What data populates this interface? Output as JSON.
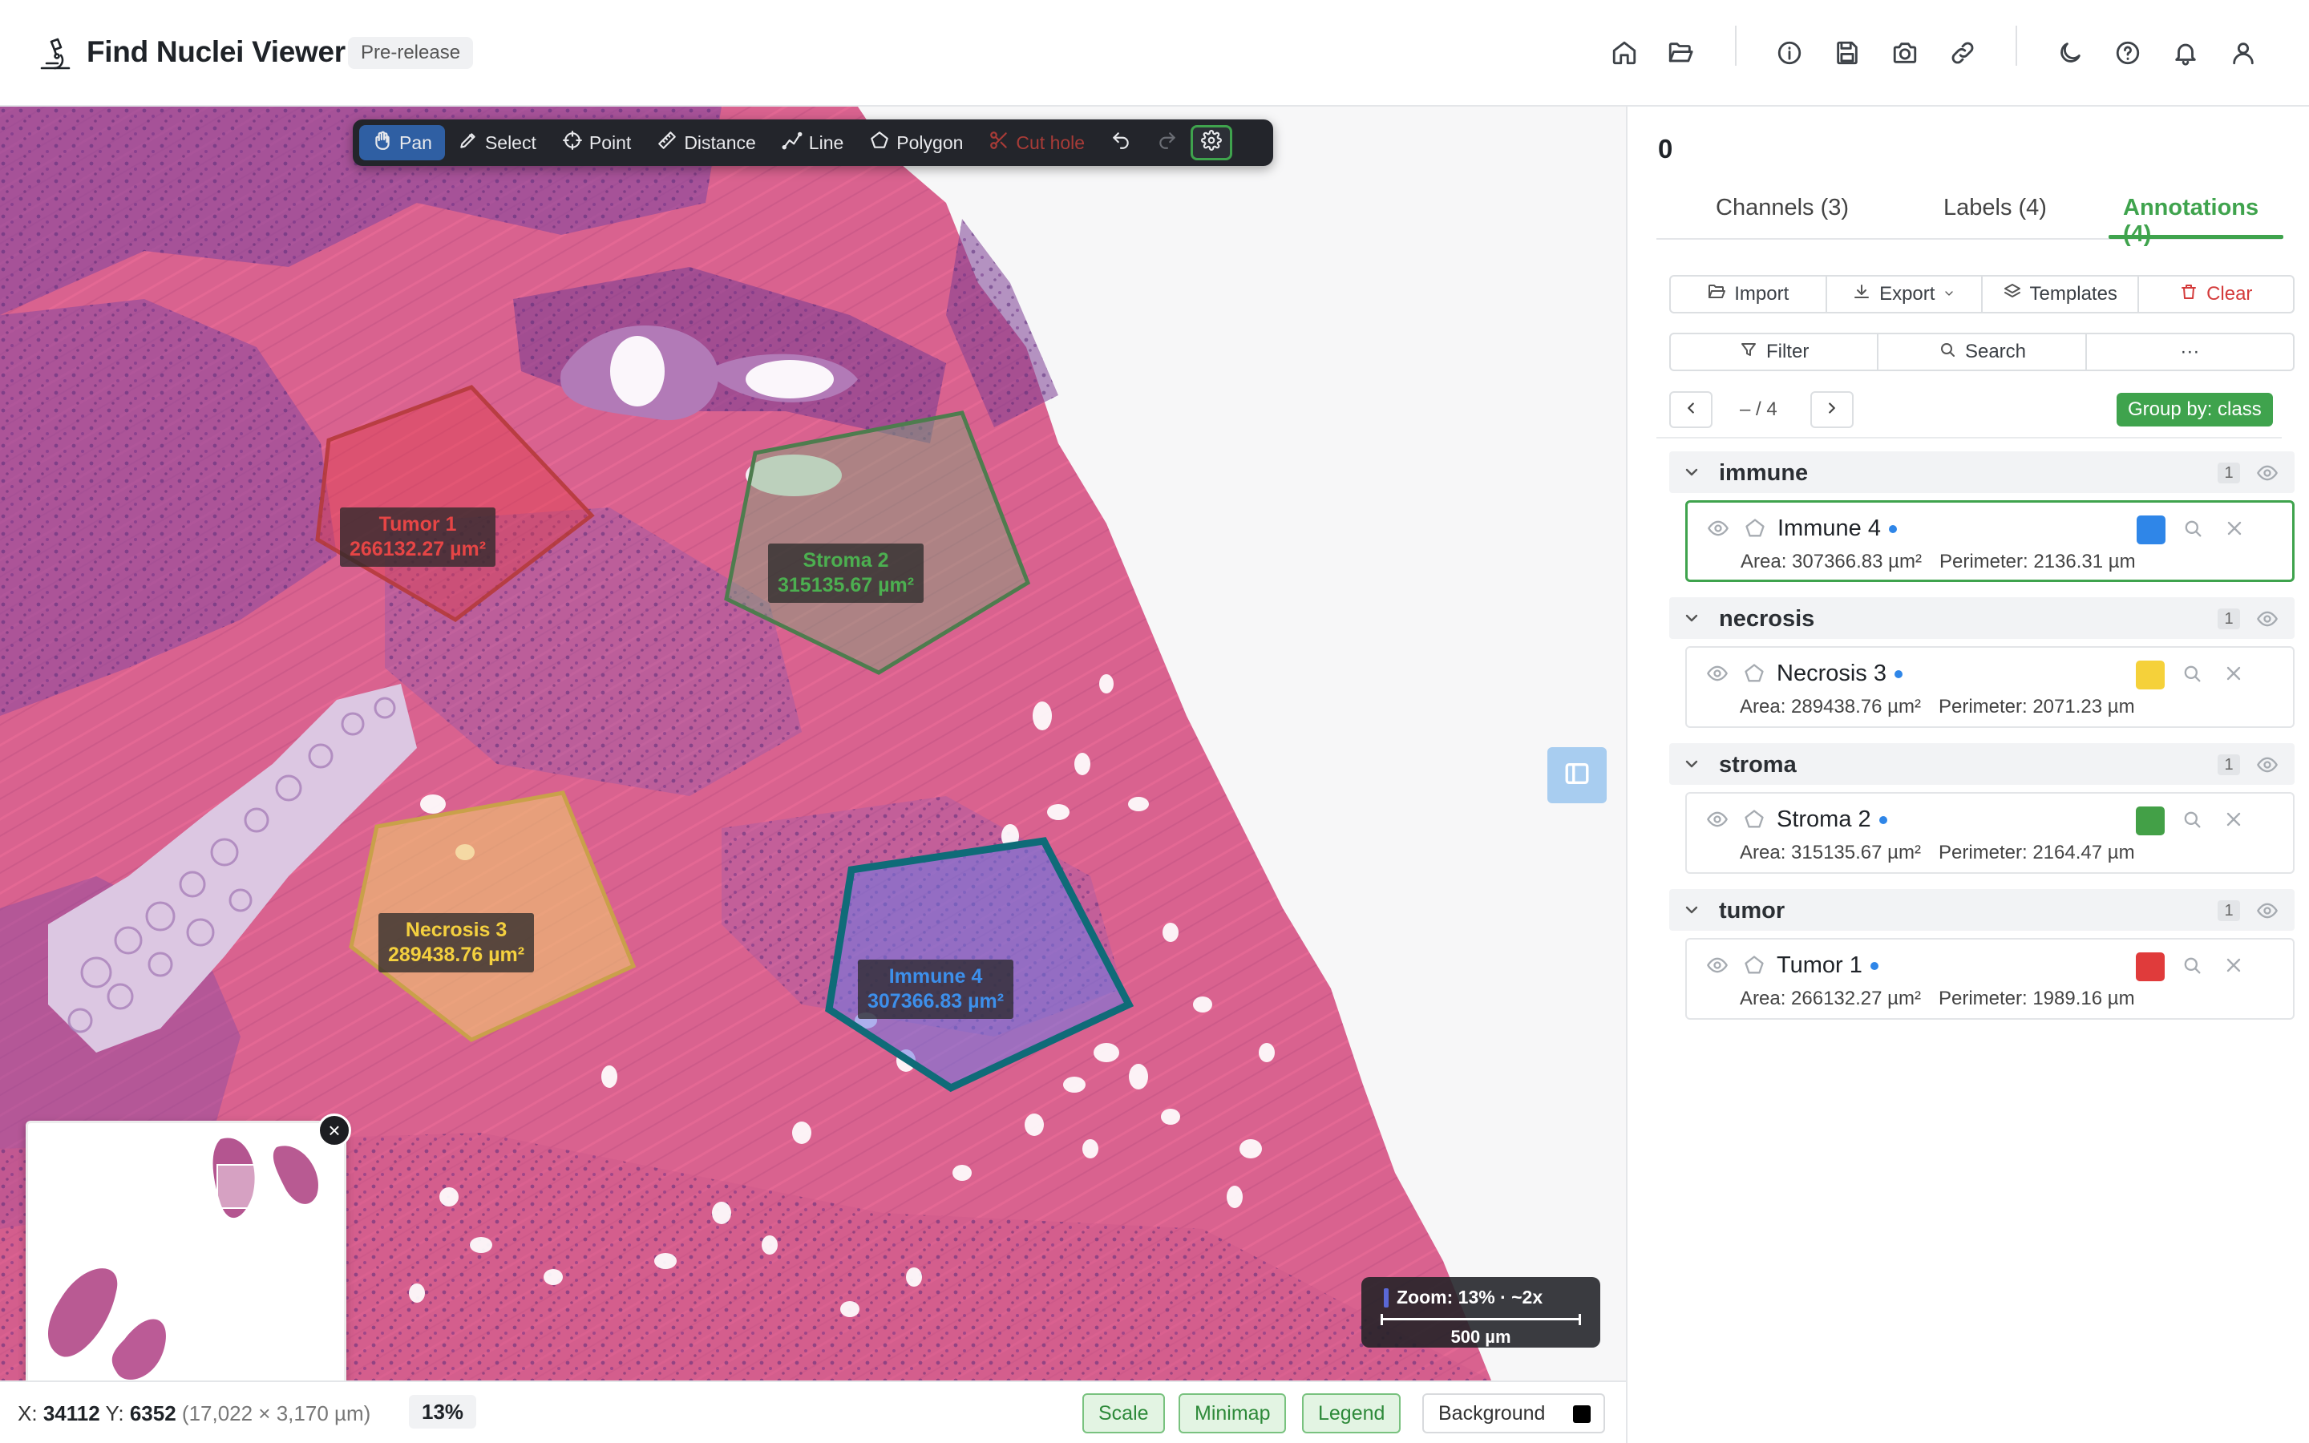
{
  "header": {
    "app_title": "Find Nuclei Viewer",
    "badge": "Pre-release",
    "icons": [
      "home-icon",
      "folder-open-icon",
      "info-icon",
      "save-icon",
      "camera-icon",
      "link-icon",
      "moon-icon",
      "help-icon",
      "bell-icon",
      "user-icon"
    ]
  },
  "toolbar": {
    "tools": [
      {
        "label": "Pan",
        "icon": "hand-icon",
        "active": true
      },
      {
        "label": "Select",
        "icon": "pencil-icon"
      },
      {
        "label": "Point",
        "icon": "crosshair-icon"
      },
      {
        "label": "Distance",
        "icon": "ruler-icon"
      },
      {
        "label": "Line",
        "icon": "polyline-icon"
      },
      {
        "label": "Polygon",
        "icon": "pentagon-icon"
      },
      {
        "label": "Cut hole",
        "icon": "scissors-icon",
        "disabled": true
      }
    ],
    "undo_icon": "undo-icon",
    "redo_icon": "redo-icon",
    "settings_icon": "gear-icon"
  },
  "annotations_on_canvas": {
    "tumor": {
      "name": "Tumor 1",
      "area": "266132.27 µm²",
      "color": "#e03b3b"
    },
    "stroma": {
      "name": "Stroma 2",
      "area": "315135.67 µm²",
      "color": "#43a047"
    },
    "necrosis": {
      "name": "Necrosis 3",
      "area": "289438.76 µm²",
      "color": "#f4d03f"
    },
    "immune": {
      "name": "Immune 4",
      "area": "307366.83 µm²",
      "color": "#2f86e8"
    }
  },
  "zoom_overlay": {
    "zoom_text": "Zoom: 13% · ~2x",
    "scale_label": "500 µm"
  },
  "status": {
    "x_label": "X:",
    "x_value": "34112",
    "y_label": "Y:",
    "y_value": "6352",
    "dims": "(17,022 × 3,170 µm)",
    "zoom": "13%",
    "toggles": [
      "Scale",
      "Minimap",
      "Legend"
    ],
    "background_label": "Background"
  },
  "panel": {
    "count": "0",
    "tabs": [
      "Channels (3)",
      "Labels (4)",
      "Annotations (4)"
    ],
    "actions": {
      "import": "Import",
      "export": "Export",
      "templates": "Templates",
      "clear": "Clear"
    },
    "filter": "Filter",
    "search": "Search",
    "more": "···",
    "pager": "– / 4",
    "group_by": "Group by: class",
    "groups": [
      {
        "name": "immune",
        "count": "1",
        "item": {
          "name": "Immune 4",
          "color": "#2f86e8",
          "area": "Area: 307366.83 µm²",
          "perimeter": "Perimeter: 2136.31 µm",
          "selected": true
        }
      },
      {
        "name": "necrosis",
        "count": "1",
        "item": {
          "name": "Necrosis 3",
          "color": "#f5d13a",
          "area": "Area: 289438.76 µm²",
          "perimeter": "Perimeter: 2071.23 µm"
        }
      },
      {
        "name": "stroma",
        "count": "1",
        "item": {
          "name": "Stroma 2",
          "color": "#43a047",
          "area": "Area: 315135.67 µm²",
          "perimeter": "Perimeter: 2164.47 µm"
        }
      },
      {
        "name": "tumor",
        "count": "1",
        "item": {
          "name": "Tumor 1",
          "color": "#e03b3b",
          "area": "Area: 266132.27 µm²",
          "perimeter": "Perimeter: 1989.16 µm"
        }
      }
    ]
  }
}
